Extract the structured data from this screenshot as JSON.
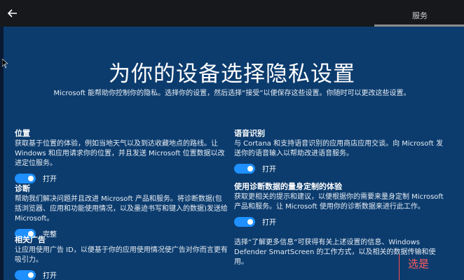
{
  "header": {
    "services_label": "服务"
  },
  "main": {
    "title": "为你的设备选择隐私设置",
    "subtitle": "Microsoft 能帮助你控制你的隐私。选择你的设置，然后选择“接受”以便保存这些设置。你随时可以更改这些设置。"
  },
  "settings": [
    {
      "heading": "位置",
      "desc": "获取基于位置的体验，例如当地天气以及到达收藏地点的路线。让 Windows 和应用请求你的位置，并且发送 Microsoft 位置数据以改进定位服务。",
      "toggle": "打开"
    },
    {
      "heading": "诊断",
      "desc": "帮助我们解决问题并且改进 Microsoft 产品和服务。将诊断数据(包括浏览器、应用和功能使用情况，以及墨迹书写和键入的数据)发送给 Microsoft。",
      "toggle": "完整"
    },
    {
      "heading": "相关广告",
      "desc": "让应用使用广告 ID，以便基于你的应用使用情况使广告对你而言更有吸引力。",
      "toggle": "打开"
    },
    {
      "heading": "语音识别",
      "desc": "与 Cortana 和支持语音识别的应用商店应用交谈。向 Microsoft 发送你的语音输入以帮助改进语音服务。",
      "toggle": "打开"
    },
    {
      "heading": "使用诊断数据的量身定制的体验",
      "desc": "获取更相关的提示和建议，以便根据你的需要来量身定制 Microsoft 产品和服务。让 Microsoft 使用你的诊断数据来进行此工作。",
      "toggle": "打开"
    }
  ],
  "more_info": "选择“了解更多信息”可获得有关上述设置的信息、Windows Defender SmartScreen 的工作方式，以及相关的数据传输和使用。",
  "annotation": "选是"
}
